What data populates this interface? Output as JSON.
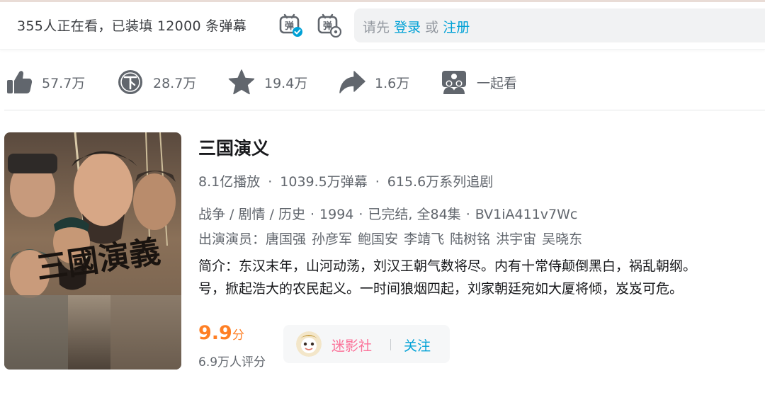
{
  "danmaku_bar": {
    "viewer_text": "355人正在看，已装填 12000 条弹幕",
    "toggle_label": "弹",
    "input_prefix": "请先",
    "login_link": "登录",
    "or_text": "或",
    "register_link": "注册"
  },
  "actions": {
    "like_count": "57.7万",
    "coin_count": "28.7万",
    "favorite_count": "19.4万",
    "share_count": "1.6万",
    "watch_together_label": "一起看"
  },
  "info": {
    "title": "三国演义",
    "views": "8.1亿播放",
    "danmaku": "1039.5万弹幕",
    "follows": "615.6万系列追剧",
    "dot": "·",
    "genres": "战争 / 剧情 / 历史",
    "year": "1994",
    "status": "已完结, 全84集",
    "bvid": "BV1iA411v7Wc",
    "cast_label": "出演演员：",
    "cast": [
      "唐国强",
      "孙彦军",
      "鲍国安",
      "李靖飞",
      "陆树铭",
      "洪宇宙",
      "吴晓东"
    ],
    "intro_line1": "简介：东汉末年，山河动荡，刘汉王朝气数将尽。内有十常侍颠倒黑白，祸乱朝纲。",
    "intro_line2": "号，掀起浩大的农民起义。一时间狼烟四起，刘家朝廷宛如大厦将倾，岌岌可危。",
    "poster_title": "三國演義"
  },
  "rating": {
    "score": "9.9",
    "unit": "分",
    "count": "6.9万人评分"
  },
  "uploader": {
    "name": "迷影社",
    "divider": "|",
    "follow_label": "关注"
  },
  "colors": {
    "accent_blue": "#00a1d6",
    "pink": "#fb7299",
    "score_orange": "#ff7f24",
    "icon_gray": "#61666d"
  }
}
